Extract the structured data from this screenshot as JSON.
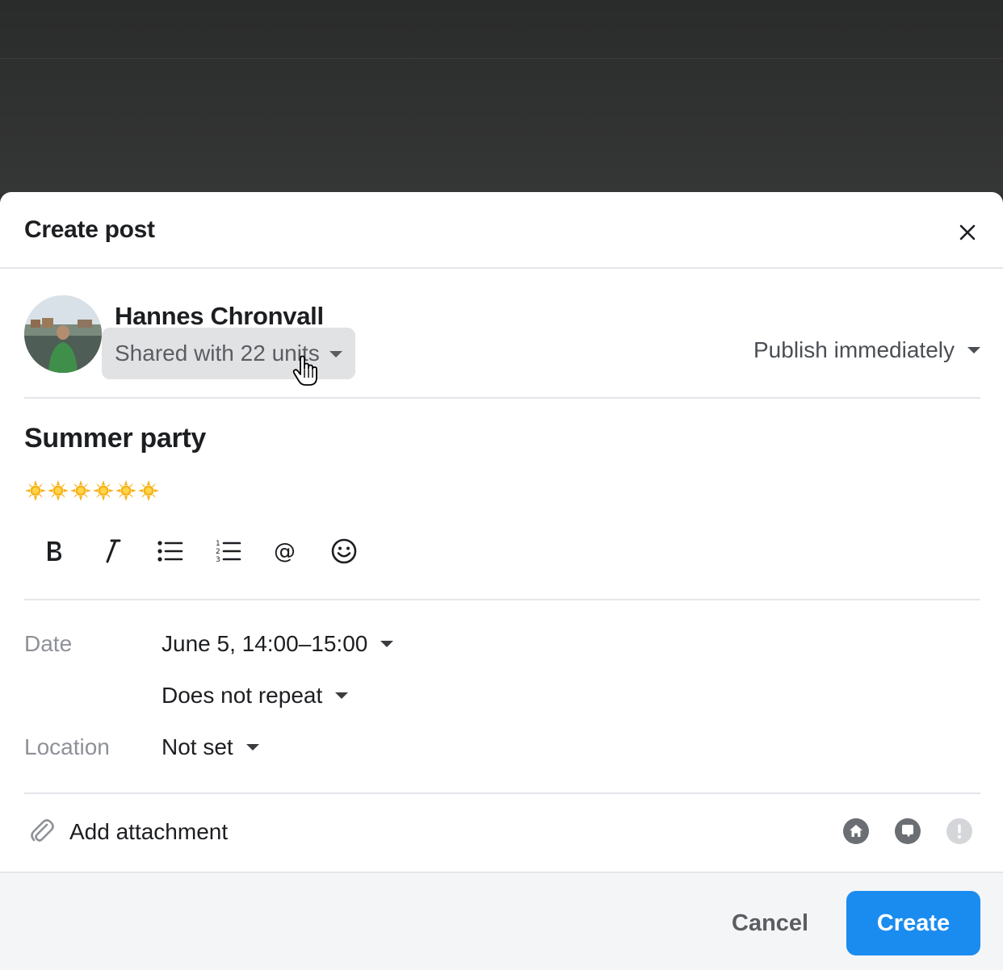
{
  "dialog": {
    "title": "Create post",
    "close_icon": "close-icon"
  },
  "author": {
    "name": "Hannes Chronvall",
    "sharing_label": "Shared with 22 units",
    "publish_label": "Publish immediately"
  },
  "post": {
    "title": "Summer party",
    "body_emoji": "sun-emoji",
    "body_emoji_count": 6
  },
  "toolbar": {
    "items": [
      "bold-icon",
      "italic-icon",
      "bulleted-list-icon",
      "numbered-list-icon",
      "mention-icon",
      "emoji-icon"
    ]
  },
  "fields": {
    "date_label": "Date",
    "date_value": "June 5, 14:00–15:00",
    "repeat_value": "Does not repeat",
    "location_label": "Location",
    "location_value": "Not set"
  },
  "attachment": {
    "label": "Add attachment",
    "icon": "paperclip-icon"
  },
  "status_icons": [
    "home-icon",
    "chat-bubble-icon",
    "alert-icon"
  ],
  "footer": {
    "cancel_label": "Cancel",
    "create_label": "Create"
  },
  "colors": {
    "primary": "#1a8cf0",
    "backdrop": "#2f3031",
    "muted_text": "#8e9197"
  }
}
